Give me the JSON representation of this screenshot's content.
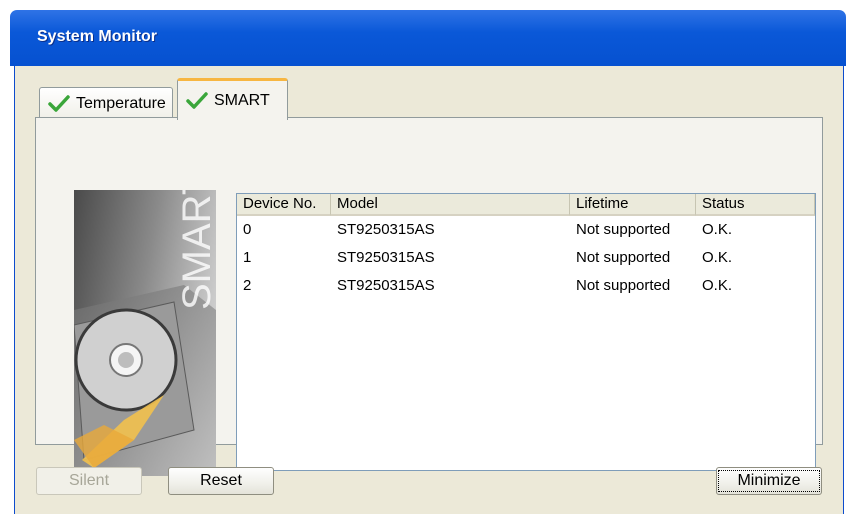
{
  "window": {
    "title": "System Monitor"
  },
  "tabs": [
    {
      "label": "Temperature",
      "icon": "check-icon",
      "selected": false
    },
    {
      "label": "SMART",
      "icon": "check-icon",
      "selected": true
    }
  ],
  "image_panel": {
    "text": "SMART"
  },
  "table": {
    "columns": [
      "Device No.",
      "Model",
      "Lifetime",
      "Status"
    ],
    "rows": [
      {
        "device": "0",
        "model": "ST9250315AS",
        "lifetime": "Not supported",
        "status": "O.K."
      },
      {
        "device": "1",
        "model": "ST9250315AS",
        "lifetime": "Not supported",
        "status": "O.K."
      },
      {
        "device": "2",
        "model": "ST9250315AS",
        "lifetime": "Not supported",
        "status": "O.K."
      }
    ]
  },
  "buttons": {
    "silent": "Silent",
    "reset": "Reset",
    "minimize": "Minimize"
  },
  "colors": {
    "titlebar": "#0a58d8",
    "check": "#3aa63a",
    "active_tab_accent": "#f7b642"
  }
}
